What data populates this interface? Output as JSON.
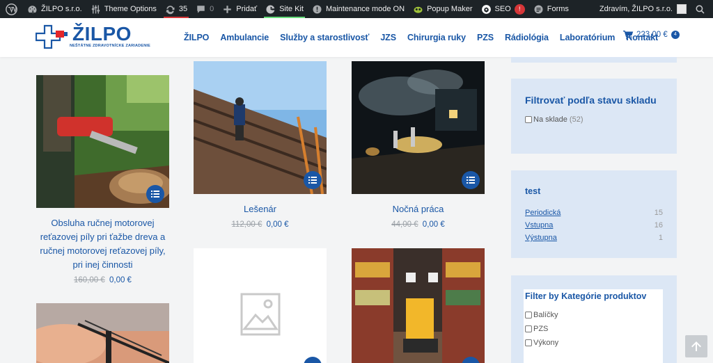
{
  "admin_bar": {
    "site_name": "ŽILPO s.r.o.",
    "theme_options": "Theme Options",
    "updates_count": "35",
    "comments_count": "0",
    "new_label": "Pridať",
    "site_kit": "Site Kit",
    "maintenance": "Maintenance mode ON",
    "popup_maker": "Popup Maker",
    "seo": "SEO",
    "seo_badge": "!",
    "forms": "Forms",
    "greeting": "Zdravím, ŽILPO s.r.o."
  },
  "header": {
    "logo_title": "ŽILPO",
    "logo_subtitle": "NEŠTÁTNE ZDRAVOTNÍCKE ZARIADENIE",
    "nav": [
      "ŽILPO",
      "Ambulancie",
      "Služby a starostlivosť",
      "JZS",
      "Chirurgia ruky",
      "PZS",
      "Rádiológia",
      "Laboratórium",
      "Kontakt"
    ],
    "cart_total": "223,00 €",
    "cart_count": "4"
  },
  "products": [
    {
      "title": "Obsluha ručnej motorovej reťazovej píly pri ťažbe dreva a ručnej motorovej reťazovej píly, pri inej činnosti",
      "old_price": "160,00 €",
      "price": "0,00 €"
    },
    {
      "title": "Lešenár",
      "old_price": "112,00 €",
      "price": "0,00 €"
    },
    {
      "title": "Nočná práca",
      "old_price": "44,00 €",
      "price": "0,00 €"
    }
  ],
  "sidebar": {
    "stock_filter": {
      "title": "Filtrovať podľa stavu skladu",
      "option": "Na sklade",
      "count": "(52)"
    },
    "test_widget": {
      "title": "test",
      "items": [
        {
          "label": "Periodická",
          "count": "15"
        },
        {
          "label": "Vstupna",
          "count": "16"
        },
        {
          "label": "Výstupna",
          "count": "1"
        }
      ]
    },
    "category_filter": {
      "title": "Filter by Kategórie produktov",
      "options": [
        "Balíčky",
        "PZS",
        "Výkony"
      ]
    }
  },
  "colors": {
    "brand_blue": "#1a57a6",
    "admin_bar": "#1d2327",
    "widget_bg": "#dce7f5",
    "logo_red": "#e3262b"
  },
  "icons": {
    "product_button": "list-icon",
    "cart": "cart-icon",
    "scroll_top": "arrow-up-icon"
  }
}
